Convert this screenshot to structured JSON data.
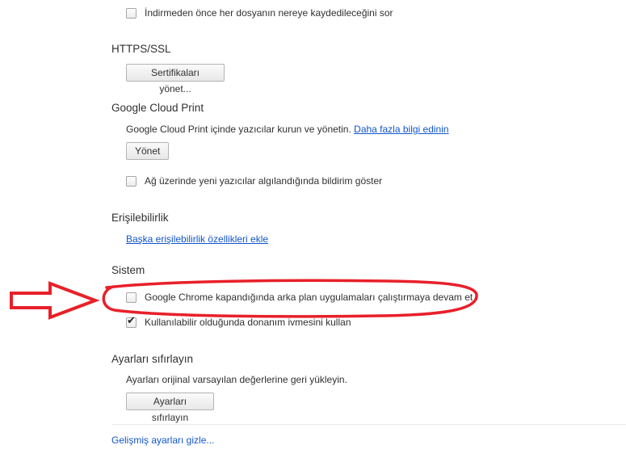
{
  "downloads": {
    "ask_location_label": "İndirmeden önce her dosyanın nereye kaydedileceğini sor",
    "ask_location_checked": false
  },
  "https_ssl": {
    "heading": "HTTPS/SSL",
    "manage_certificates_label": "Sertifikaları yönet..."
  },
  "cloud_print": {
    "heading": "Google Cloud Print",
    "description": "Google Cloud Print içinde yazıcılar kurun ve yönetin.",
    "learn_more_link": "Daha fazla bilgi edinin",
    "manage_button_label": "Yönet",
    "notify_new_printers_label": "Ağ üzerinde yeni yazıcılar algılandığında bildirim göster",
    "notify_new_printers_checked": false
  },
  "accessibility": {
    "heading": "Erişilebilirlik",
    "add_features_link": "Başka erişilebilirlik özellikleri ekle"
  },
  "system": {
    "heading": "Sistem",
    "background_apps_label": "Google Chrome kapandığında arka plan uygulamaları çalıştırmaya devam et",
    "background_apps_checked": false,
    "hardware_accel_label": "Kullanılabilir olduğunda donanım ivmesini kullan",
    "hardware_accel_checked": true
  },
  "reset": {
    "heading": "Ayarları sıfırlayın",
    "description": "Ayarları orijinal varsayılan değerlerine geri yükleyin.",
    "button_label": "Ayarları sıfırlayın"
  },
  "footer": {
    "hide_advanced_link": "Gelişmiş ayarları gizle..."
  },
  "annotation": {
    "color": "#e8202a",
    "arrow_icon": "right-arrow-outline-icon",
    "highlight_shape": "ellipse"
  }
}
